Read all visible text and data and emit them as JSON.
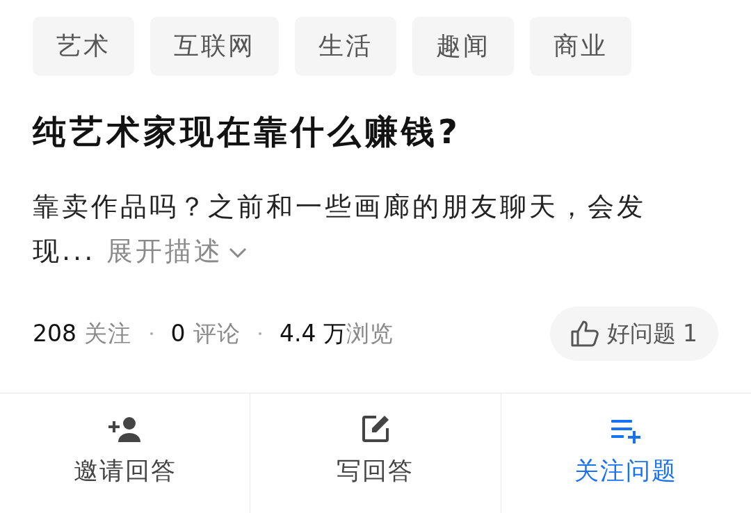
{
  "tags": [
    {
      "label": "艺术"
    },
    {
      "label": "互联网"
    },
    {
      "label": "生活"
    },
    {
      "label": "趣闻"
    },
    {
      "label": "商业"
    }
  ],
  "title": "纯艺术家现在靠什么赚钱?",
  "description": {
    "text": "靠卖作品吗？之前和一些画廊的朋友聊天，会发现...",
    "expand": "展开描述"
  },
  "stats": [
    {
      "text": "**208** 关注"
    },
    {
      "text": "**0** 评论"
    },
    {
      "text": "**4.4 万**浏览"
    }
  ],
  "good_question": {
    "label": "好问题 1"
  },
  "actions": [
    {
      "kind": "invite",
      "label": "邀请回答",
      "active": false
    },
    {
      "kind": "write",
      "label": "写回答",
      "active": false
    },
    {
      "kind": "follow",
      "label": "关注问题",
      "active": true
    }
  ]
}
